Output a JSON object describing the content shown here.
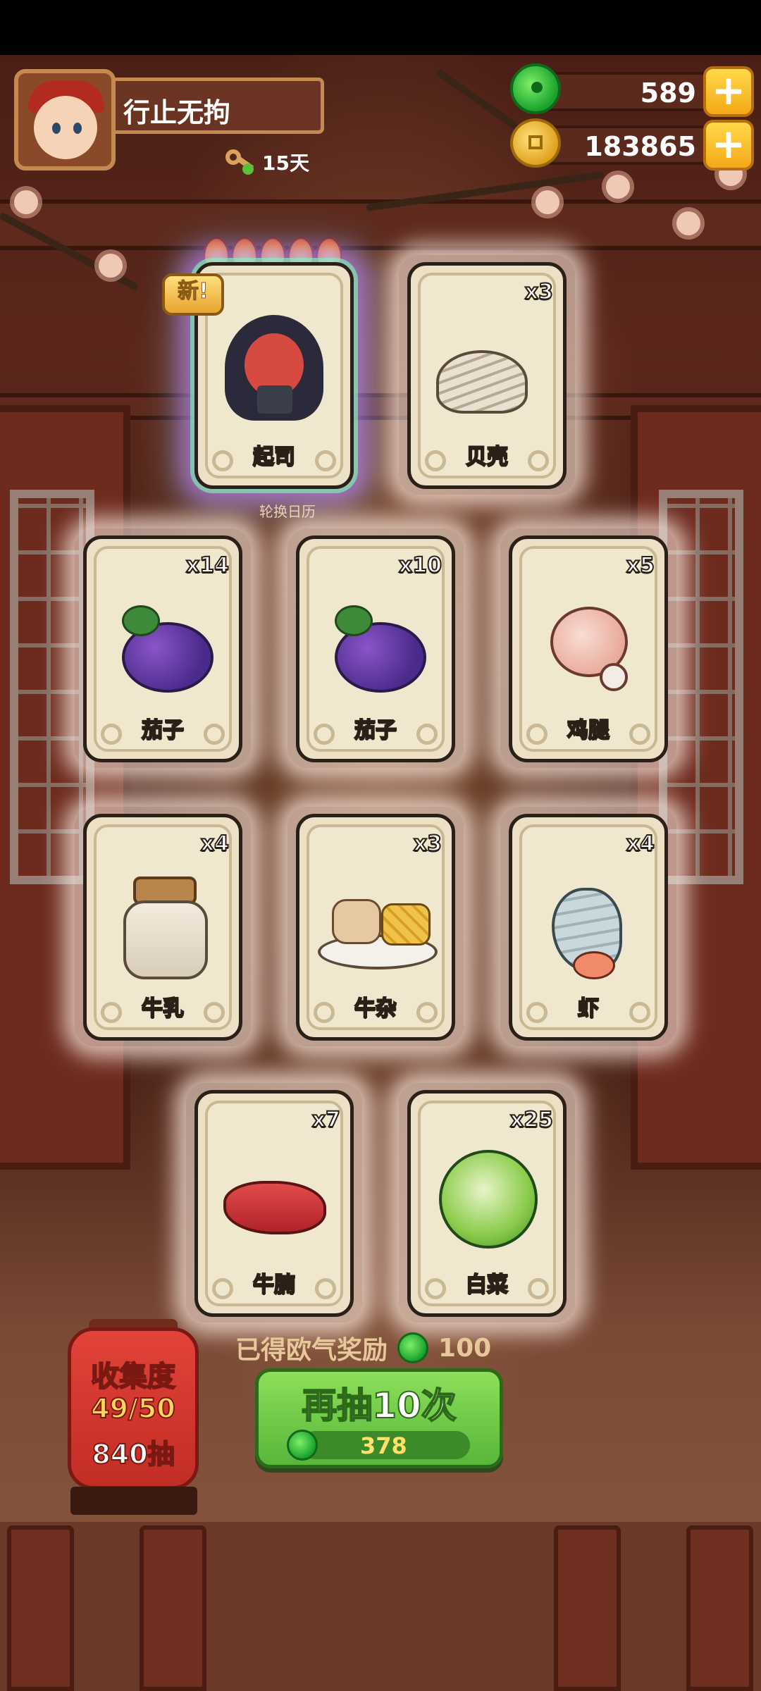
{
  "player": {
    "name": "行止无拘",
    "days": "15天"
  },
  "resources": {
    "gems": "589",
    "coins": "183865"
  },
  "featured": {
    "new_label": "新!",
    "stars": 5,
    "rotate_label": "轮换日历"
  },
  "cards": [
    {
      "label": "起司",
      "count": "",
      "icon": "cheese-girl-character"
    },
    {
      "label": "贝壳",
      "count": "x3",
      "icon": "clam-icon"
    },
    {
      "label": "茄子",
      "count": "x14",
      "icon": "eggplant-icon"
    },
    {
      "label": "茄子",
      "count": "x10",
      "icon": "eggplant-icon"
    },
    {
      "label": "鸡腿",
      "count": "x5",
      "icon": "drumstick-icon"
    },
    {
      "label": "牛乳",
      "count": "x4",
      "icon": "milk-jar-icon"
    },
    {
      "label": "牛杂",
      "count": "x3",
      "icon": "beef-offal-icon"
    },
    {
      "label": "虾",
      "count": "x4",
      "icon": "shrimp-icon"
    },
    {
      "label": "牛腩",
      "count": "x7",
      "icon": "beef-brisket-icon"
    },
    {
      "label": "白菜",
      "count": "x25",
      "icon": "cabbage-icon"
    }
  ],
  "reward": {
    "text": "已得欧气奖励",
    "amount": "100"
  },
  "redraw": {
    "label": "再抽10次",
    "cost": "378"
  },
  "collection": {
    "title": "收集度",
    "progress": "49/50",
    "draws": "840抽"
  },
  "colors": {
    "button_green": "#6cc448",
    "lantern_red": "#d4382f",
    "card_paper": "#ece1c6",
    "gem_green": "#19a12c",
    "coin_gold": "#e0a220"
  }
}
